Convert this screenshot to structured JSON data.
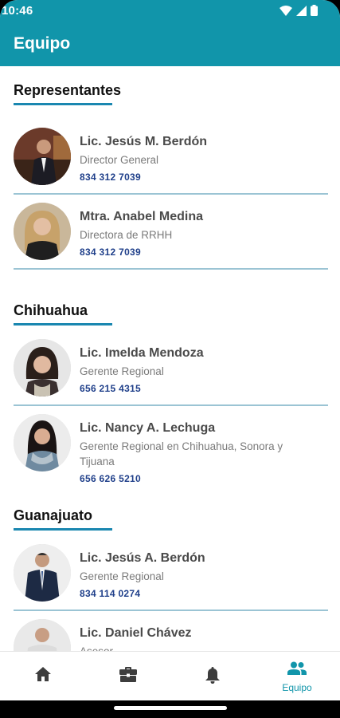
{
  "status_bar": {
    "time": "10:46"
  },
  "app_bar": {
    "title": "Equipo"
  },
  "sections": [
    {
      "title": "Representantes",
      "people": [
        {
          "name": "Lic. Jesús M. Berdón",
          "role": "Director General",
          "phone": "834 312 7039"
        },
        {
          "name": "Mtra. Anabel Medina",
          "role": "Directora de RRHH",
          "phone": "834 312 7039"
        }
      ]
    },
    {
      "title": "Chihuahua",
      "people": [
        {
          "name": "Lic. Imelda Mendoza",
          "role": "Gerente Regional",
          "phone": "656 215 4315"
        },
        {
          "name": "Lic. Nancy A. Lechuga",
          "role": "Gerente Regional en Chihuahua, Sonora y Tijuana",
          "phone": "656 626 5210"
        }
      ]
    },
    {
      "title": "Guanajuato",
      "people": [
        {
          "name": "Lic. Jesús A. Berdón",
          "role": "Gerente Regional",
          "phone": "834 114 0274"
        },
        {
          "name": "Lic. Daniel Chávez",
          "role": "Asesor",
          "phone": ""
        }
      ]
    }
  ],
  "bottom_nav": {
    "items": [
      {
        "icon": "home-icon"
      },
      {
        "icon": "briefcase-icon"
      },
      {
        "icon": "bell-icon"
      },
      {
        "icon": "people-icon",
        "label": "Equipo",
        "active": true
      }
    ]
  },
  "colors": {
    "primary": "#1195aa",
    "accent_underline": "#1a87b0",
    "phone_text": "#1f3f8a",
    "divider": "#9bc4d4"
  }
}
